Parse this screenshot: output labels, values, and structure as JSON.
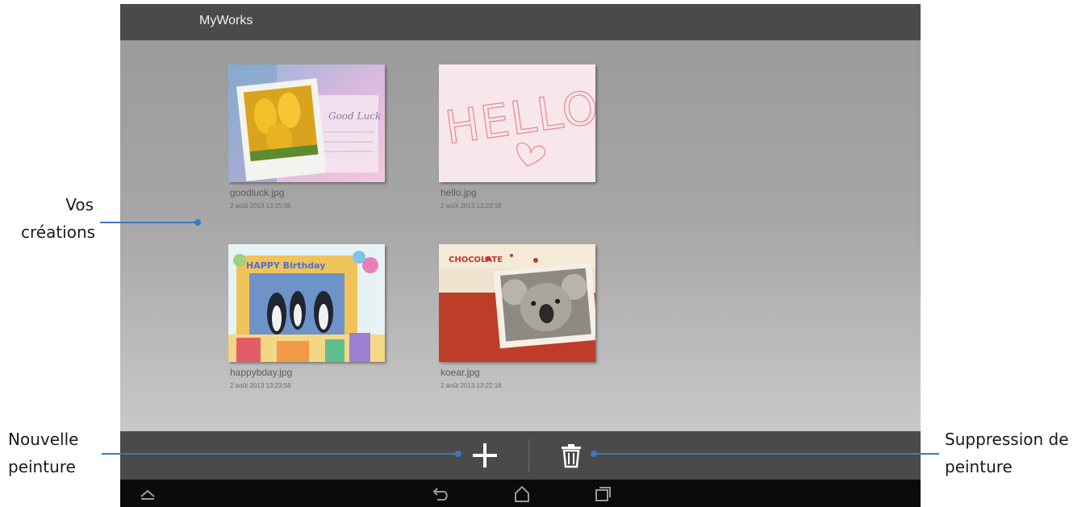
{
  "app": {
    "title": "MyWorks"
  },
  "works": [
    {
      "name": "goodluck.jpg",
      "date": "2 août 2013 13:25:06",
      "thumbnail_icon": "goodluck-card-thumbnail",
      "overlay_text": "Good Luck"
    },
    {
      "name": "hello.jpg",
      "date": "2 août 2013 13:23:18",
      "thumbnail_icon": "hello-drawing-thumbnail",
      "overlay_text": "HELLO"
    },
    {
      "name": "happybday.jpg",
      "date": "2 août 2013 13:23:58",
      "thumbnail_icon": "birthday-card-thumbnail",
      "overlay_text": "HAPPY Birthday"
    },
    {
      "name": "koear.jpg",
      "date": "2 août 2013 13:22:16",
      "thumbnail_icon": "koala-card-thumbnail",
      "overlay_text": "CHOCOLATE"
    }
  ],
  "actions": {
    "new_icon": "plus-icon",
    "delete_icon": "trash-icon"
  },
  "nav": {
    "buttons": [
      "up-chevron-icon",
      "back-icon",
      "home-icon",
      "recent-apps-icon"
    ]
  },
  "annotations": {
    "creations": [
      "Vos",
      "créations"
    ],
    "new_painting": [
      "Nouvelle",
      "peinture"
    ],
    "delete_painting": [
      "Suppression de",
      "peinture"
    ]
  },
  "colors": {
    "titlebar": "#4a4a4a",
    "actionbar": "#4a4a4a",
    "navbar": "#0b0b0b",
    "callout_line": "#3b78c0"
  }
}
